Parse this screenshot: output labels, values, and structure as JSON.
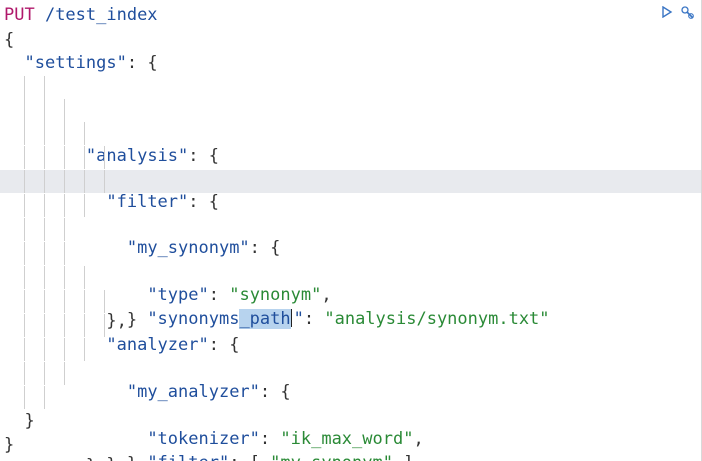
{
  "request": {
    "method": "PUT",
    "path": " /test_index"
  },
  "body": {
    "open": "{",
    "close": "}",
    "settings_key": "\"settings\"",
    "analysis_key": "\"analysis\"",
    "filter_key": "\"filter\"",
    "my_synonym_key": "\"my_synonym\"",
    "type_key": "\"type\"",
    "type_value": "\"synonym\"",
    "synonyms_path_key_a": "\"synonyms",
    "synonyms_path_key_sel": "_path",
    "synonyms_path_key_b": "\"",
    "synonyms_path_value": "\"analysis/synonym.txt\"",
    "analyzer_key": "\"analyzer\"",
    "my_analyzer_key": "\"my_analyzer\"",
    "tokenizer_key": "\"tokenizer\"",
    "tokenizer_value": "\"ik_max_word\"",
    "filter2_key": "\"filter\"",
    "filter2_value": "\"my_synonym\""
  },
  "colors": {
    "method": "#b0186b",
    "key": "#1f4e9c",
    "string": "#2a8a36",
    "active_line": "#e8eaee",
    "selection": "#b7d3ee"
  },
  "toolbar": {
    "run_icon": "play-icon",
    "settings_icon": "wrench-icon"
  }
}
